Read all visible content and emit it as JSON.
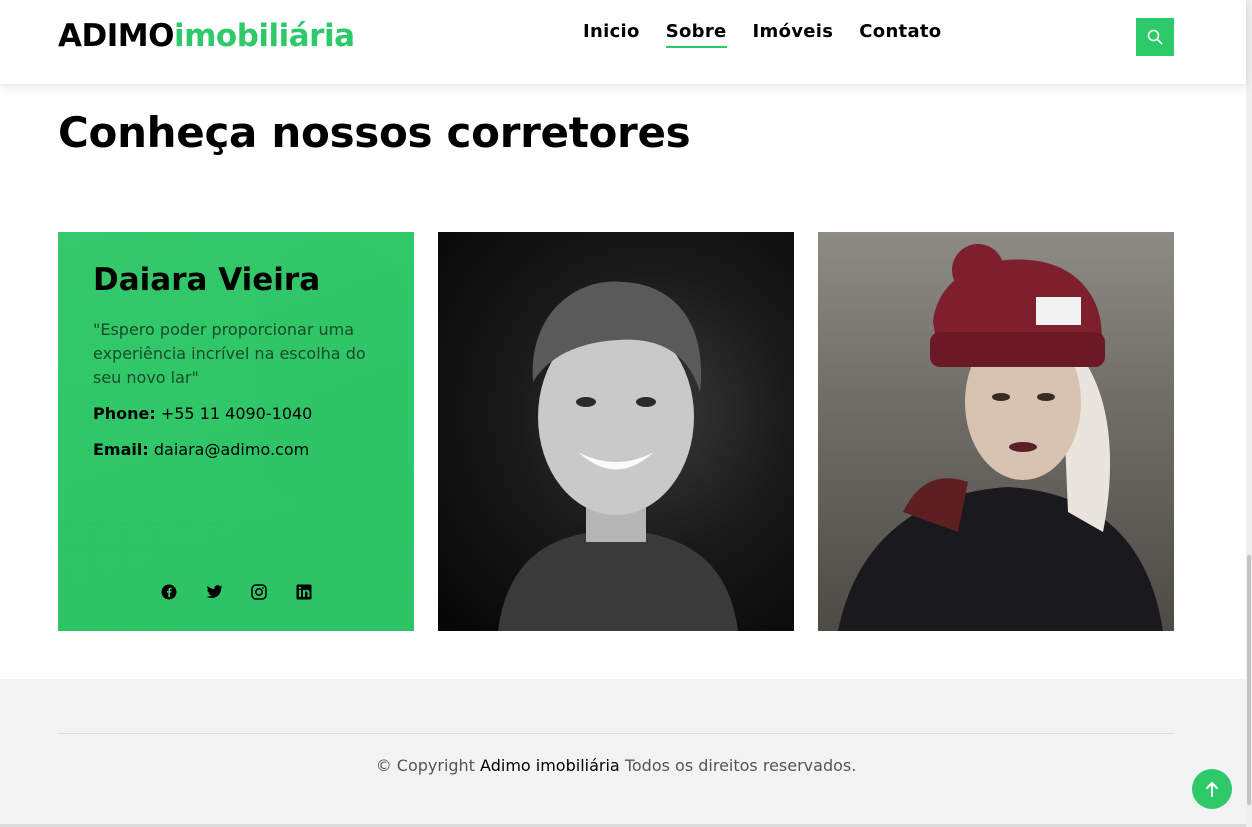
{
  "header": {
    "logo_part1": "ADIMO",
    "logo_part2": "imobiliária",
    "nav": [
      {
        "label": "Inicio",
        "active": false
      },
      {
        "label": "Sobre",
        "active": true
      },
      {
        "label": "Imóveis",
        "active": false
      },
      {
        "label": "Contato",
        "active": false
      }
    ],
    "search_icon": "search-icon"
  },
  "section": {
    "title": "Conheça nossos corretores"
  },
  "agents": [
    {
      "name": "Daiara Vieira",
      "quote": "\"Espero poder proporcionar uma experiência incrível na escolha do seu novo lar\"",
      "phone_label": "Phone:",
      "phone": "+55 11 4090-1040",
      "email_label": "Email:",
      "email": "daiara@adimo.com",
      "socials": [
        "facebook-icon",
        "twitter-icon",
        "instagram-icon",
        "linkedin-icon"
      ]
    }
  ],
  "footer": {
    "copyright_prefix": "© Copyright",
    "brand": "Adimo imobiliária",
    "copyright_suffix": "Todos os direitos reservados."
  },
  "colors": {
    "accent": "#2eca6a"
  }
}
